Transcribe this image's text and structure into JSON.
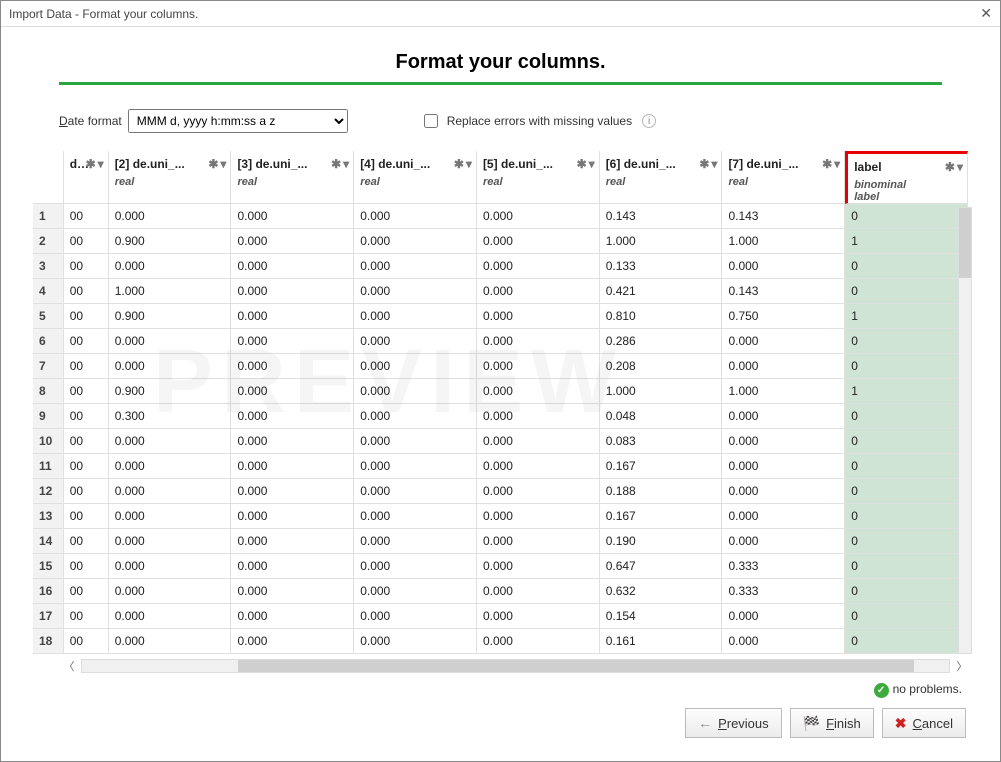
{
  "window_title": "Import Data - Format your columns.",
  "page_title": "Format your columns.",
  "date_format_label": "Date format",
  "date_format_value": "MMM d, yyyy h:mm:ss a z",
  "replace_errors_label": "Replace errors with missing values",
  "watermark": "PREVIEW",
  "status": {
    "ok": true,
    "text": "no problems."
  },
  "buttons": {
    "previous": "Previous",
    "finish": "Finish",
    "cancel": "Cancel"
  },
  "columns": [
    {
      "name": "de.uni_...",
      "type": "",
      "role": "",
      "partial": true
    },
    {
      "name": "[2] de.uni_...",
      "type": "real",
      "role": ""
    },
    {
      "name": "[3] de.uni_...",
      "type": "real",
      "role": ""
    },
    {
      "name": "[4] de.uni_...",
      "type": "real",
      "role": ""
    },
    {
      "name": "[5] de.uni_...",
      "type": "real",
      "role": ""
    },
    {
      "name": "[6] de.uni_...",
      "type": "real",
      "role": ""
    },
    {
      "name": "[7] de.uni_...",
      "type": "real",
      "role": ""
    },
    {
      "name": "label",
      "type": "binominal",
      "role": "label",
      "highlighted": true
    }
  ],
  "rows": [
    {
      "n": 1,
      "v": [
        "00",
        "0.000",
        "0.000",
        "0.000",
        "0.000",
        "0.143",
        "0.143",
        "0"
      ]
    },
    {
      "n": 2,
      "v": [
        "00",
        "0.900",
        "0.000",
        "0.000",
        "0.000",
        "1.000",
        "1.000",
        "1"
      ]
    },
    {
      "n": 3,
      "v": [
        "00",
        "0.000",
        "0.000",
        "0.000",
        "0.000",
        "0.133",
        "0.000",
        "0"
      ]
    },
    {
      "n": 4,
      "v": [
        "00",
        "1.000",
        "0.000",
        "0.000",
        "0.000",
        "0.421",
        "0.143",
        "0"
      ]
    },
    {
      "n": 5,
      "v": [
        "00",
        "0.900",
        "0.000",
        "0.000",
        "0.000",
        "0.810",
        "0.750",
        "1"
      ]
    },
    {
      "n": 6,
      "v": [
        "00",
        "0.000",
        "0.000",
        "0.000",
        "0.000",
        "0.286",
        "0.000",
        "0"
      ]
    },
    {
      "n": 7,
      "v": [
        "00",
        "0.000",
        "0.000",
        "0.000",
        "0.000",
        "0.208",
        "0.000",
        "0"
      ]
    },
    {
      "n": 8,
      "v": [
        "00",
        "0.900",
        "0.000",
        "0.000",
        "0.000",
        "1.000",
        "1.000",
        "1"
      ]
    },
    {
      "n": 9,
      "v": [
        "00",
        "0.300",
        "0.000",
        "0.000",
        "0.000",
        "0.048",
        "0.000",
        "0"
      ]
    },
    {
      "n": 10,
      "v": [
        "00",
        "0.000",
        "0.000",
        "0.000",
        "0.000",
        "0.083",
        "0.000",
        "0"
      ]
    },
    {
      "n": 11,
      "v": [
        "00",
        "0.000",
        "0.000",
        "0.000",
        "0.000",
        "0.167",
        "0.000",
        "0"
      ]
    },
    {
      "n": 12,
      "v": [
        "00",
        "0.000",
        "0.000",
        "0.000",
        "0.000",
        "0.188",
        "0.000",
        "0"
      ]
    },
    {
      "n": 13,
      "v": [
        "00",
        "0.000",
        "0.000",
        "0.000",
        "0.000",
        "0.167",
        "0.000",
        "0"
      ]
    },
    {
      "n": 14,
      "v": [
        "00",
        "0.000",
        "0.000",
        "0.000",
        "0.000",
        "0.190",
        "0.000",
        "0"
      ]
    },
    {
      "n": 15,
      "v": [
        "00",
        "0.000",
        "0.000",
        "0.000",
        "0.000",
        "0.647",
        "0.333",
        "0"
      ]
    },
    {
      "n": 16,
      "v": [
        "00",
        "0.000",
        "0.000",
        "0.000",
        "0.000",
        "0.632",
        "0.333",
        "0"
      ]
    },
    {
      "n": 17,
      "v": [
        "00",
        "0.000",
        "0.000",
        "0.000",
        "0.000",
        "0.154",
        "0.000",
        "0"
      ]
    },
    {
      "n": 18,
      "v": [
        "00",
        "0.000",
        "0.000",
        "0.000",
        "0.000",
        "0.161",
        "0.000",
        "0"
      ]
    }
  ]
}
